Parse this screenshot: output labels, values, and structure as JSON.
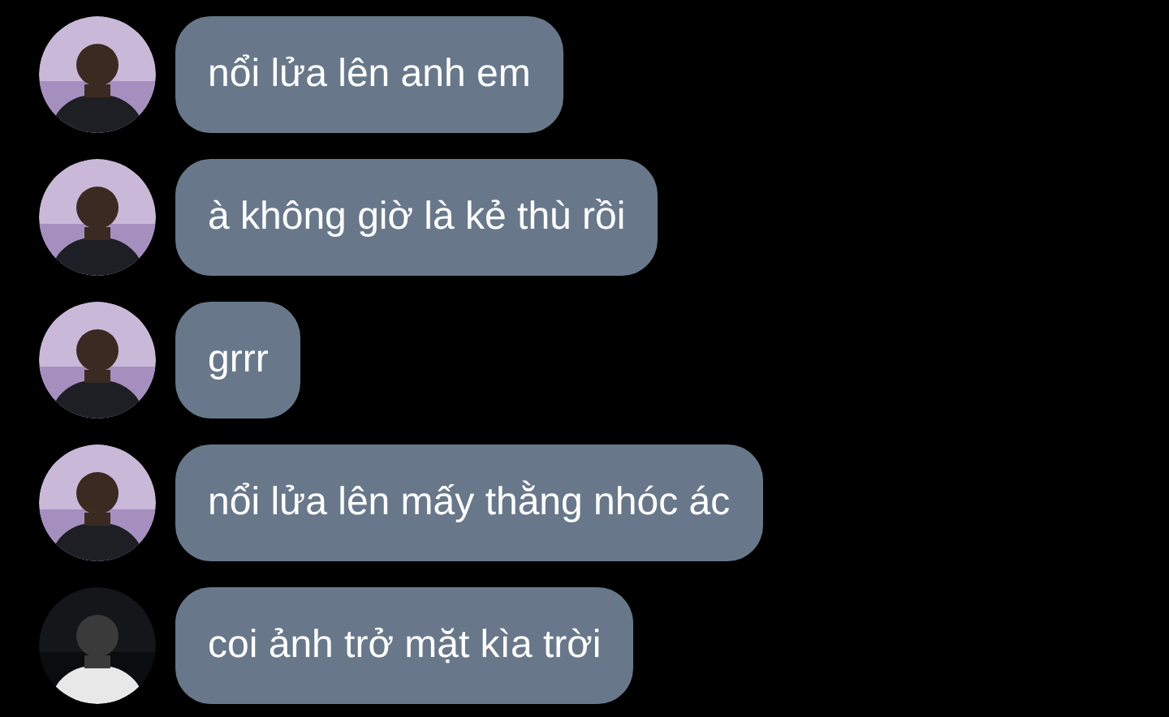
{
  "messages": [
    {
      "text": "nổi lửa lên anh em",
      "avatar": {
        "kind": "light"
      }
    },
    {
      "text": "à không giờ là kẻ thù rồi",
      "avatar": {
        "kind": "light"
      }
    },
    {
      "text": "grrr",
      "avatar": {
        "kind": "light"
      }
    },
    {
      "text": "nổi lửa lên mấy thằng nhóc ác",
      "avatar": {
        "kind": "light"
      }
    },
    {
      "text": "coi ảnh trở mặt kìa trời",
      "avatar": {
        "kind": "dark"
      }
    }
  ]
}
